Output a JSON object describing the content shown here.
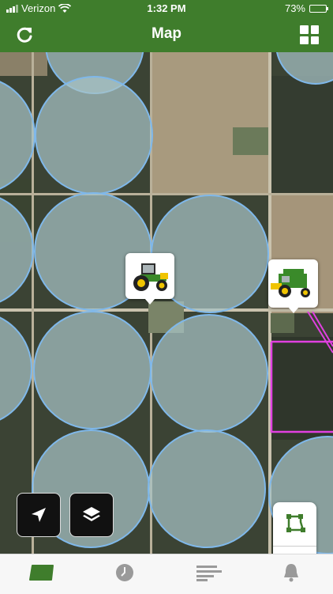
{
  "status_bar": {
    "carrier": "Verizon",
    "time": "1:32 PM",
    "battery": "73%",
    "battery_level": 0.73
  },
  "header": {
    "title": "Map",
    "refresh_icon": "refresh-icon",
    "menu_icon": "grid-icon"
  },
  "map": {
    "equipment_pins": [
      {
        "type": "tractor",
        "icon": "tractor-icon"
      },
      {
        "type": "combine",
        "icon": "combine-icon"
      }
    ],
    "controls": {
      "locate_icon": "location-arrow-icon",
      "layers_icon": "layers-icon",
      "draw_boundary_icon": "boundary-draw-icon",
      "equipment_icon": "tractor-icon"
    },
    "colors": {
      "field_outline": "#7fb8ea",
      "selected_boundary": "#e040e0",
      "brand_green": "#3f7d2c"
    }
  },
  "tab_bar": {
    "tabs": [
      {
        "name": "fields",
        "icon": "field-icon",
        "active": true
      },
      {
        "name": "history",
        "icon": "clock-icon",
        "active": false
      },
      {
        "name": "list",
        "icon": "list-icon",
        "active": false
      },
      {
        "name": "alerts",
        "icon": "bell-icon",
        "active": false
      }
    ]
  }
}
